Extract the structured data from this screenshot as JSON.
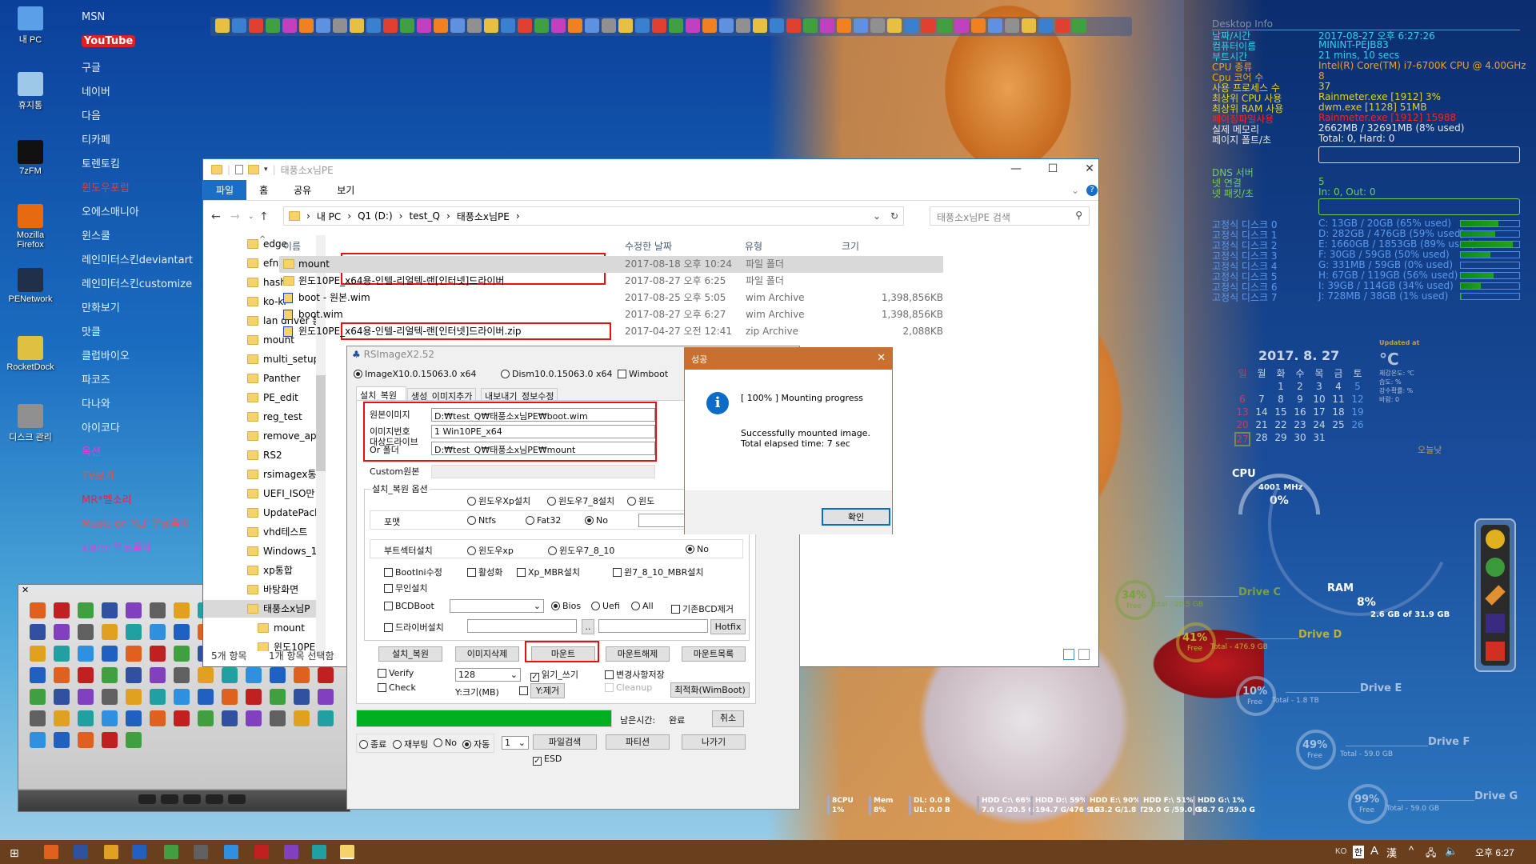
{
  "desktop": {
    "icons": [
      {
        "label": "내 PC",
        "color": "#5aa0e8"
      },
      {
        "label": "휴지통",
        "color": "#9ec8e8"
      },
      {
        "label": "7zFM",
        "color": "#111111"
      },
      {
        "label": "Mozilla Firefox",
        "color": "#e86a10"
      },
      {
        "label": "PENetwork",
        "color": "#20304a"
      },
      {
        "label": "RocketDock",
        "color": "#e0c040"
      },
      {
        "label": "디스크 관리",
        "color": "#909090"
      }
    ],
    "links": [
      {
        "label": "MSN",
        "color": "#e8f0ff"
      },
      {
        "label": "YouTube",
        "color": "#ffffff"
      },
      {
        "label": "구글",
        "color": "#e8f0ff"
      },
      {
        "label": "네이버",
        "color": "#e8f0ff"
      },
      {
        "label": "다음",
        "color": "#e8f0ff"
      },
      {
        "label": "티카페",
        "color": "#e8f0ff"
      },
      {
        "label": "토렌토킴",
        "color": "#e8f0ff"
      },
      {
        "label": "윈도우포럼",
        "color": "#e04040"
      },
      {
        "label": "오에스매니아",
        "color": "#e8f0ff"
      },
      {
        "label": "윈스쿨",
        "color": "#e8f0ff"
      },
      {
        "label": "레인미터스킨deviantart",
        "color": "#e8f0ff"
      },
      {
        "label": "레인미터스킨customize",
        "color": "#e8f0ff"
      },
      {
        "label": "만화보기",
        "color": "#e8f0ff"
      },
      {
        "label": "맛클",
        "color": "#e8f0ff"
      },
      {
        "label": "클럽바이오",
        "color": "#e8f0ff"
      },
      {
        "label": "파코즈",
        "color": "#e8f0ff"
      },
      {
        "label": "다나와",
        "color": "#e8f0ff"
      },
      {
        "label": "아이코다",
        "color": "#e8f0ff"
      },
      {
        "label": "옥션",
        "color": "#e040e0"
      },
      {
        "label": "TV보기",
        "color": "#e85050"
      },
      {
        "label": "MR*벨소리",
        "color": "#f02040"
      },
      {
        "label": "Music on YLT 무료음악",
        "color": "#f05050"
      },
      {
        "label": "xiami 무료음악",
        "color": "#e040e0"
      }
    ]
  },
  "explorer": {
    "title": "태풍소x님PE",
    "ribbon": [
      "파일",
      "홈",
      "공유",
      "보기"
    ],
    "breadcrumb": [
      "내 PC",
      "Q1 (D:)",
      "test_Q",
      "태풍소x님PE"
    ],
    "search_placeholder": "태풍소x님PE 검색",
    "nav": [
      "edge",
      "efny",
      "hash",
      "ko-kr",
      "lan driver 통",
      "mount",
      "multi_setup",
      "Panther",
      "PE_edit",
      "reg_test",
      "remove_app",
      "RS2",
      "rsimagex통",
      "UEFI_ISO만",
      "UpdatePack",
      "vhd테스트",
      "Windows_1",
      "xp통합",
      "바탕화면",
      "태풍소x님P",
      "mount",
      "윈도10PE"
    ],
    "nav_selected": 19,
    "columns": [
      "이름",
      "수정한 날짜",
      "유형",
      "크기"
    ],
    "files": [
      {
        "name": "mount",
        "date": "2017-08-18 오후 10:24",
        "type": "파일 폴더",
        "size": "",
        "icon": "folder"
      },
      {
        "name": "윈도10PE_x64용-인텔-리얼텍-랜[인터넷]드라이버",
        "date": "2017-08-27 오후 6:25",
        "type": "파일 폴더",
        "size": "",
        "icon": "folder"
      },
      {
        "name": "boot - 원본.wim",
        "date": "2017-08-25 오후 5:05",
        "type": "wim Archive",
        "size": "1,398,856KB",
        "icon": "archive"
      },
      {
        "name": "boot.wim",
        "date": "2017-08-27 오후 6:27",
        "type": "wim Archive",
        "size": "1,398,856KB",
        "icon": "archive"
      },
      {
        "name": "윈도10PE_x64용-인텔-리얼텍-랜[인터넷]드라이버.zip",
        "date": "2017-04-27 오전 12:41",
        "type": "zip Archive",
        "size": "2,088KB",
        "icon": "archive"
      }
    ],
    "status_count": "5개 항목",
    "status_selected": "1개 항목 선택함"
  },
  "rsimagex": {
    "title": "RSImageX2.52",
    "engine_imagex": "ImageX10.0.15063.0 x64",
    "engine_dism": "Dism10.0.15063.0 x64",
    "wimboot": "Wimboot",
    "tabs": [
      "설치_복원",
      "생성_이미지추가",
      "내보내기_정보수정"
    ],
    "source_label": "원본이미지",
    "source_value": "D:₩test_Q₩태풍소x님PE₩boot.wim",
    "index_label": "이미지번호",
    "index_value": "1  Win10PE_x64",
    "target_label": "대상드라이브",
    "target_label2": "Or 폴더",
    "target_value": "D:₩test_Q₩태풍소x님PE₩mount",
    "custom_label": "Custom원본",
    "group_label": "설치_복원 옵션",
    "install_opts": [
      "윈도우Xp설치",
      "윈도우7_8설치",
      "윈도"
    ],
    "format_label": "포맷",
    "format_opts": [
      "Ntfs",
      "Fat32",
      "No"
    ],
    "format_selected": "No",
    "boot_label": "부트섹터설치",
    "boot_opts": [
      "윈도우xp",
      "윈도우7_8_10",
      "No"
    ],
    "boot_selected": "No",
    "checks1": [
      "BootIni수정",
      "활성화",
      "Xp_MBR설치",
      "윈7_8_10_MBR설치"
    ],
    "unattend": "무인설치",
    "bcdboot": "BCDBoot",
    "bcd_opts": [
      "Bios",
      "Uefi",
      "All"
    ],
    "bcd_selected": "Bios",
    "bcd_remove": "기존BCD제거",
    "driver": "드라이버설치",
    "browse": "..",
    "hotfix": "Hotfix",
    "actions": [
      "설치_복원",
      "이미지삭제",
      "마운트",
      "마운트해제",
      "마운트목록"
    ],
    "verify": "Verify",
    "check": "Check",
    "chunk": "128",
    "readwrite": "읽기_쓰기",
    "readwrite_checked": true,
    "save_changes": "변경사항저장",
    "cleanup": "Cleanup",
    "ysize": "Y:크기(MB)",
    "yremove": "Y:제거",
    "optimize": "최적화(WimBoot)",
    "progress": 100,
    "remaining_label": "남은시간:",
    "remaining_value": "완료",
    "cancel": "취소",
    "after_opts": [
      "종료",
      "재부팅",
      "No",
      "자동"
    ],
    "after_selected": "자동",
    "count": "1",
    "filesearch": "파일검색",
    "partition": "파티션",
    "exit": "나가기",
    "esd": "ESD",
    "esd_checked": true,
    "progress_color": "#00b020"
  },
  "dialog": {
    "title": "성공",
    "line1": "[ 100% ] Mounting progress",
    "line2": "Successfully mounted image.",
    "line3": "Total elapsed time: 7 sec",
    "ok": "확인"
  },
  "desktop_info": {
    "title": "Desktop Info",
    "rows": [
      {
        "label": "날짜/시간",
        "value": "2017-08-27 오후 6:27:26",
        "color": "#2bd3f0"
      },
      {
        "label": "컴퓨터이름",
        "value": "MININT-PEJB83",
        "color": "#2bd3f0"
      },
      {
        "label": "부트시간",
        "value": "21 mins, 10 secs",
        "color": "#2bd3f0"
      },
      {
        "label": "CPU 종류",
        "value": "Intel(R) Core(TM) i7-6700K CPU @ 4.00GHz",
        "color": "#f0a020"
      },
      {
        "label": "Cpu 코어 수",
        "value": "8",
        "color": "#f0a020"
      },
      {
        "label": "사용 프로세스 수",
        "value": "37",
        "color": "#e8d020"
      },
      {
        "label": "최상위 CPU 사용",
        "value": "Rainmeter.exe [1912] 3%",
        "color": "#e8d020"
      },
      {
        "label": "최상위 RAM 사용",
        "value": "dwm.exe [1128] 51MB",
        "color": "#e8d020"
      },
      {
        "label": "페이징파일사용",
        "value": "Rainmeter.exe [1912] 15988",
        "color": "#ff2020"
      },
      {
        "label": "실제 메모리",
        "value": "2662MB / 32691MB (8% used)",
        "color": "#e8e8e8"
      },
      {
        "label": "페이지 폴트/초",
        "value": "Total: 0, Hard: 0",
        "color": "#e8e8e8"
      }
    ],
    "net_rows": [
      {
        "label": "DNS 서버",
        "value": "",
        "color": "#70d050"
      },
      {
        "label": "넷 연결",
        "value": "5",
        "color": "#70d050"
      },
      {
        "label": "넷 패킷/초",
        "value": "In: 0, Out: 0",
        "color": "#70d050"
      }
    ],
    "disks": [
      {
        "label": "고정식 디스크 0",
        "value": "C: 13GB / 20GB (65% used)",
        "used": 65
      },
      {
        "label": "고정식 디스크 1",
        "value": "D: 282GB / 476GB (59% used)",
        "used": 59
      },
      {
        "label": "고정식 디스크 2",
        "value": "E: 1660GB / 1853GB (89% used)",
        "used": 89
      },
      {
        "label": "고정식 디스크 3",
        "value": "F: 30GB / 59GB (50% used)",
        "used": 50
      },
      {
        "label": "고정식 디스크 4",
        "value": "G: 331MB / 59GB (0% used)",
        "used": 0
      },
      {
        "label": "고정식 디스크 5",
        "value": "H: 67GB / 119GB (56% used)",
        "used": 56
      },
      {
        "label": "고정식 디스크 6",
        "value": "I: 39GB / 114GB (34% used)",
        "used": 34
      },
      {
        "label": "고정식 디스크 7",
        "value": "J: 728MB / 38GB (1% used)",
        "used": 1
      }
    ],
    "disk_color": "#5a9af0"
  },
  "calendar": {
    "header": "2017. 8. 27",
    "weekdays": [
      "일",
      "월",
      "화",
      "수",
      "목",
      "금",
      "토"
    ],
    "first_weekday": 2,
    "days": 31,
    "today": 27
  },
  "weather": {
    "updated": "Updated at",
    "temp": "°C",
    "feels": "체감온도: ℃",
    "humidity": "습도: %",
    "rain": "강수확률: %",
    "wind": "바람:  0",
    "today": "오늘낮"
  },
  "gauges": {
    "cpu_label": "CPU",
    "cpu_mhz": "4001 MHz",
    "cpu_pct": "0%",
    "ram_label": "RAM",
    "ram_pct": "8%",
    "ram_detail": "2.6 GB of 31.9 GB"
  },
  "drives": [
    {
      "name": "Drive C",
      "free": "34%",
      "free_label": "Free",
      "total": "Total - 20.5 GB",
      "color": "#7aa040"
    },
    {
      "name": "Drive D",
      "free": "41%",
      "free_label": "Free",
      "total": "Total - 476.9 GB",
      "color": "#c0b030"
    },
    {
      "name": "Drive E",
      "free": "10%",
      "free_label": "Free",
      "total": "Total - 1.8 TB",
      "color": "#a8c0e0"
    },
    {
      "name": "Drive F",
      "free": "49%",
      "free_label": "Free",
      "total": "Total - 59.0 GB",
      "color": "#a8c0e0"
    },
    {
      "name": "Drive G",
      "free": "99%",
      "free_label": "Free",
      "total": "Total - 59.0 GB",
      "color": "#a8c0e0"
    }
  ],
  "meters": [
    {
      "l1": "8CPU",
      "l2": "1%"
    },
    {
      "l1": "Mem",
      "l2": "8%"
    },
    {
      "l1": "DL:   0.0 B",
      "l2": "UL:   0.0 B"
    },
    {
      "l1": "HDD C:\\  66%",
      "l2": "7.0 G  /20.5 G"
    },
    {
      "l1": "HDD D:\\  59%",
      "l2": "194.7 G/476.9 G"
    },
    {
      "l1": "HDD E:\\  90%",
      "l2": "193.2 G/1.8 T"
    },
    {
      "l1": "HDD F:\\  51%",
      "l2": "29.0 G  /59.0 G"
    },
    {
      "l1": "HDD G:\\  1%",
      "l2": "58.7 G  /59.0 G"
    }
  ],
  "taskbar": {
    "lang": "KO",
    "ime": "한",
    "ime2": "A",
    "hanja": "漢",
    "clock": "오후 6:27",
    "color": "#6a3f1e"
  }
}
